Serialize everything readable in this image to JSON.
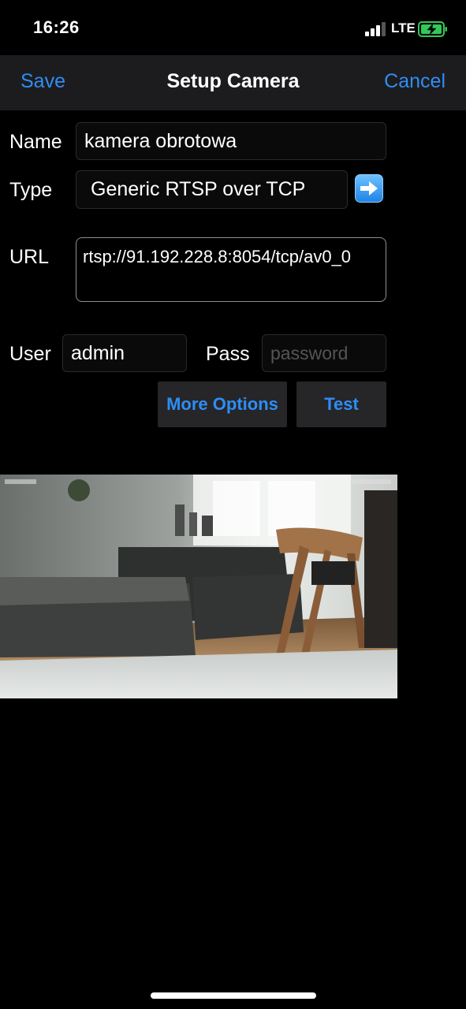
{
  "status": {
    "time": "16:26",
    "network": "LTE"
  },
  "nav": {
    "save": "Save",
    "title": "Setup Camera",
    "cancel": "Cancel"
  },
  "form": {
    "name_label": "Name",
    "name_value": "kamera obrotowa",
    "type_label": "Type",
    "type_value": "Generic RTSP over TCP",
    "url_label": "URL",
    "url_value": "rtsp://91.192.228.8:8054/tcp/av0_0",
    "user_label": "User",
    "user_value": "admin",
    "pass_label": "Pass",
    "pass_placeholder": "password"
  },
  "buttons": {
    "more_options": "More Options",
    "test": "Test"
  },
  "colors": {
    "accent": "#2f8df5",
    "nav_bg": "#1c1c1e",
    "button_bg": "#262628",
    "battery": "#34c759"
  }
}
